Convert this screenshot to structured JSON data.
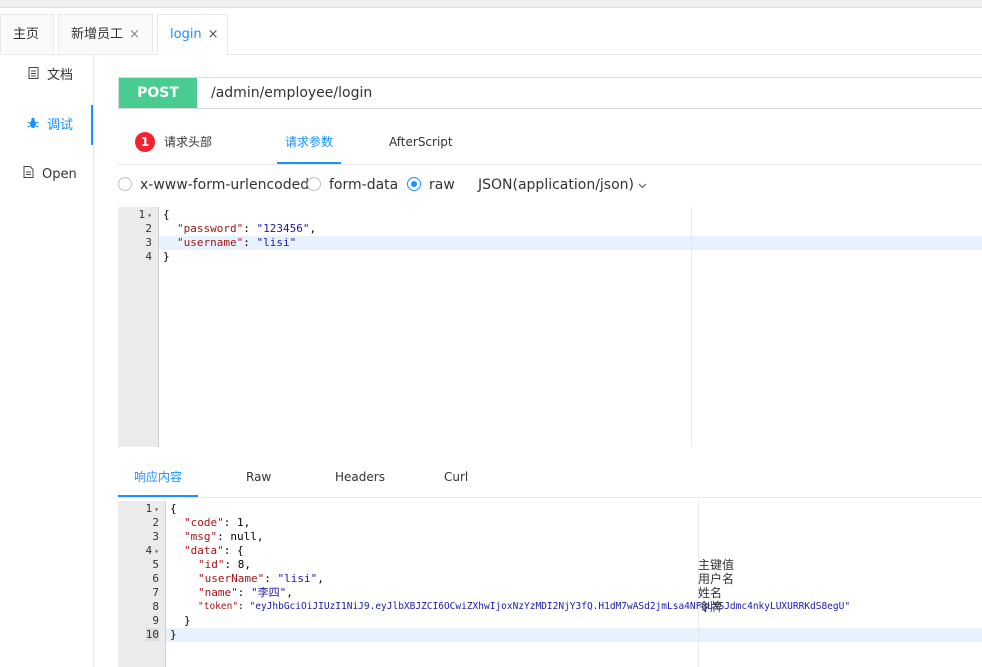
{
  "tabs": [
    {
      "label": "主页"
    },
    {
      "label": "新增员工",
      "close": "×"
    },
    {
      "label": "login",
      "close": "×"
    }
  ],
  "sidebar": {
    "items": [
      {
        "label": "文档",
        "icon": "document-icon"
      },
      {
        "label": "调试",
        "icon": "bug-icon"
      },
      {
        "label": "Open",
        "icon": "file-icon"
      }
    ]
  },
  "request": {
    "method": "POST",
    "url": "/admin/employee/login",
    "tabs": [
      "请求头部",
      "请求参数",
      "AfterScript"
    ],
    "header_count": "1",
    "body_types": [
      "x-www-form-urlencoded",
      "form-data",
      "raw"
    ],
    "content_type": "JSON(application/json)",
    "lines": [
      {
        "num": "1",
        "fold": "▾"
      },
      {
        "num": "2"
      },
      {
        "num": "3"
      },
      {
        "num": "4"
      }
    ],
    "code": [
      {
        "p": "{"
      },
      {
        "k": "\"password\"",
        "c": ": ",
        "s": "\"123456\"",
        "t": ","
      },
      {
        "k": "\"username\"",
        "c": ": ",
        "s": "\"lisi\""
      },
      {
        "p": "}"
      }
    ]
  },
  "response": {
    "tabs": [
      "响应内容",
      "Raw",
      "Headers",
      "Curl"
    ],
    "lines": [
      {
        "num": "1",
        "fold": "▾"
      },
      {
        "num": "2"
      },
      {
        "num": "3"
      },
      {
        "num": "4",
        "fold": "▾"
      },
      {
        "num": "5"
      },
      {
        "num": "6"
      },
      {
        "num": "7"
      },
      {
        "num": "8"
      },
      {
        "num": "9"
      },
      {
        "num": "10"
      }
    ],
    "code": [
      {
        "p": "{"
      },
      {
        "k": "\"code\"",
        "c": ": ",
        "v": "1",
        "t": ","
      },
      {
        "k": "\"msg\"",
        "c": ": ",
        "v": "null",
        "t": ","
      },
      {
        "k": "\"data\"",
        "c": ": ",
        "v": "{"
      },
      {
        "k": "\"id\"",
        "c": ": ",
        "v": "8",
        "t": ","
      },
      {
        "k": "\"userName\"",
        "c": ": ",
        "s": "\"lisi\"",
        "t": ","
      },
      {
        "k": "\"name\"",
        "c": ": ",
        "s": "\"李四\"",
        "t": ","
      },
      {
        "k": "\"token\"",
        "c": ": ",
        "s": "\"eyJhbGciOiJIUzI1NiJ9.eyJlbXBJZCI6OCwiZXhwIjoxNzYzMDI2NjY3fQ.H1dM7wASd2jmLsa4NFqLXSJdmc4nkyLUXURRKdS8egU\""
      },
      {
        "p": "}"
      },
      {
        "p": "}"
      }
    ],
    "comments": [
      {
        "line": 5,
        "text": "主键值"
      },
      {
        "line": 6,
        "text": "用户名"
      },
      {
        "line": 7,
        "text": "姓名"
      },
      {
        "line": 8,
        "text": "令牌"
      }
    ]
  },
  "colors": {
    "accent": "#1890ff",
    "post": "#49cc90",
    "badge": "#f5222d"
  }
}
